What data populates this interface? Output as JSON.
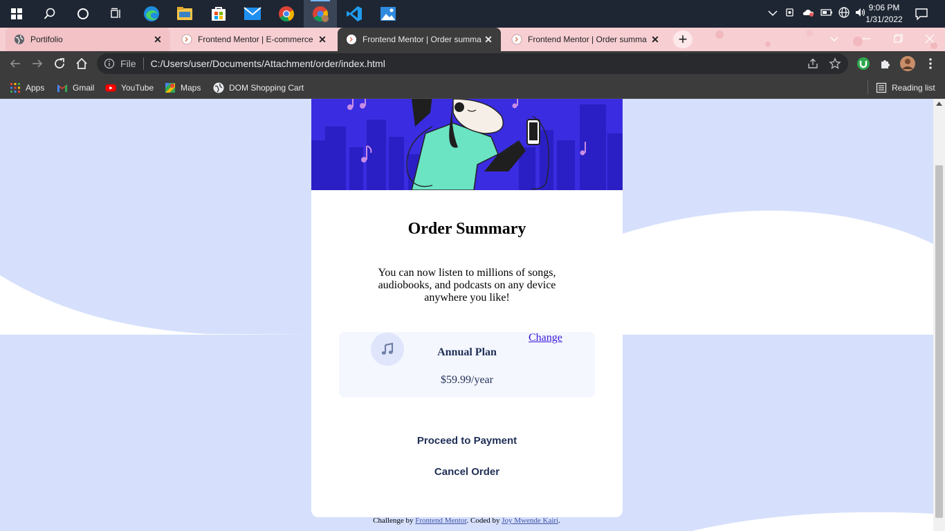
{
  "taskbar": {
    "icons": [
      "windows-start-icon",
      "search-icon",
      "cortana-icon",
      "task-view-icon",
      "edge-icon",
      "file-explorer-icon",
      "store-icon",
      "mail-icon",
      "chrome-icon",
      "chrome-profile-icon",
      "vscode-icon",
      "photos-icon"
    ],
    "clock_time": "9:06 PM",
    "clock_date": "1/31/2022"
  },
  "tabs": [
    {
      "label": "Portifolio",
      "state": "inactive"
    },
    {
      "label": "Frontend Mentor | E-commerce",
      "state": "inactive"
    },
    {
      "label": "Frontend Mentor | Order summa",
      "state": "active"
    },
    {
      "label": "Frontend Mentor | Order summa",
      "state": "inactive"
    }
  ],
  "toolbar": {
    "file_label": "File",
    "url": "C:/Users/user/Documents/Attachment/order/index.html"
  },
  "bookmarks": {
    "items": [
      "Apps",
      "Gmail",
      "YouTube",
      "Maps",
      "DOM Shopping Cart"
    ],
    "reading_list": "Reading list"
  },
  "card": {
    "title": "Order Summary",
    "description": "You can now listen to millions of songs, audiobooks, and podcasts on any device anywhere you like!",
    "plan_name": "Annual Plan",
    "plan_price": "$59.99/year",
    "change_label": "Change",
    "pay_label": "Proceed to Payment",
    "cancel_label": "Cancel Order"
  },
  "attribution": {
    "prefix": "Challenge by ",
    "link1": "Frontend Mentor",
    "middle": ". Coded by ",
    "link2": "Joy Mwende Kairi",
    "suffix": "."
  },
  "colors": {
    "page_bg": "#d6e0fc",
    "hero_bg": "#3a2ce0",
    "accent_link": "#3816d9",
    "dark_text": "#1f2f56"
  }
}
